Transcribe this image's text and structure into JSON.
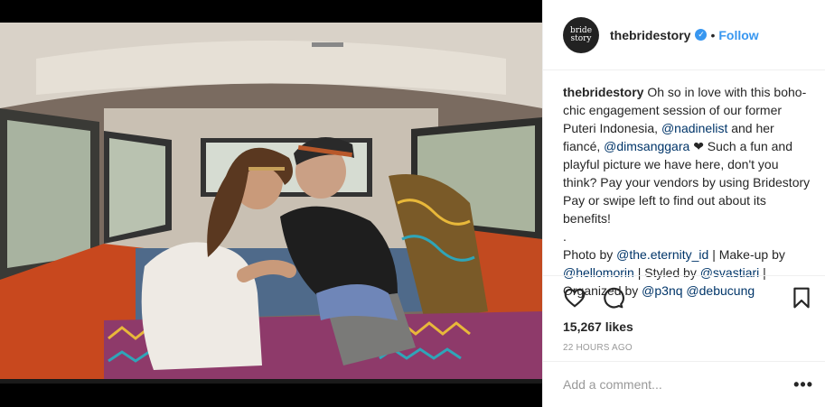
{
  "post": {
    "account": {
      "avatar_text_line1": "bride",
      "avatar_text_line2": "story",
      "username": "thebridestory",
      "verified_mark": "✓",
      "separator": "•",
      "follow_label": "Follow"
    },
    "caption": {
      "username": "thebridestory",
      "text_1": "Oh so in love with this boho-chic engagement session of our former Puteri Indonesia,",
      "mention_1": "@nadinelist",
      "text_2": "and her fiancé,",
      "mention_2": "@dimsanggara",
      "text_3": "❤ Such a fun and playful picture we have here, don't you think? Pay your vendors by using Bridestory Pay or swipe left to find out about its benefits!",
      "dot_line": ".",
      "credits_1": "Photo by",
      "mention_3": "@the.eternity_id",
      "credits_2": "| Make-up by",
      "mention_4": "@hellomorin",
      "credits_3": "| Styled by",
      "mention_5": "@svastiari",
      "credits_4": "|",
      "credits_5": "Organized by",
      "mention_6": "@p3nq",
      "mention_7": "@debucung"
    },
    "likes": "15,267 likes",
    "timestamp": "22 HOURS AGO",
    "comment_placeholder": "Add a comment...",
    "more_label": "•••",
    "colors": {
      "link": "#3897f0",
      "mention": "#003569",
      "van_orange": "#c8481e"
    }
  }
}
